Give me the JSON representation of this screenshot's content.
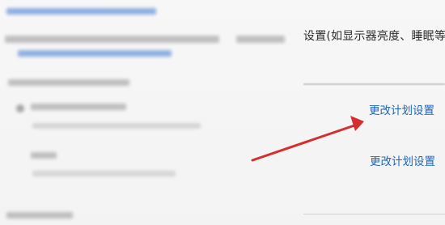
{
  "panel": {
    "description_partial": "设置(如显示器亮度、睡眠等",
    "links": [
      {
        "label": "更改计划设置"
      },
      {
        "label": "更改计划设置"
      }
    ]
  },
  "annotation": {
    "arrow_color": "#d32f2f"
  },
  "colors": {
    "link": "#1f64b7",
    "text": "#2b2b2b",
    "background": "#f4f4f4"
  }
}
